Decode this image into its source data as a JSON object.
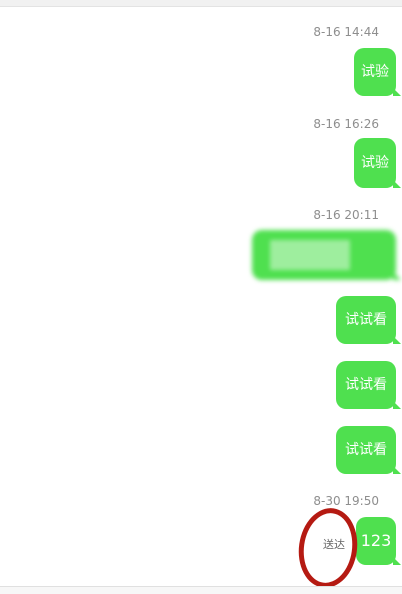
{
  "colors": {
    "bubble": "#4fe04f",
    "bubble_text": "#ffffff",
    "timestamp": "#8e8e8e",
    "annotation": "#b51a12"
  },
  "messages": [
    {
      "timestamp": "8-16 14:44",
      "text": "试验"
    },
    {
      "timestamp": "8-16 16:26",
      "text": "试验"
    },
    {
      "timestamp": "8-16 20:11",
      "text": "",
      "blurred": true
    },
    {
      "text": "试试看"
    },
    {
      "text": "试试看"
    },
    {
      "text": "试试看"
    },
    {
      "timestamp": "8-30 19:50",
      "text": "123",
      "status": "送达"
    }
  ]
}
